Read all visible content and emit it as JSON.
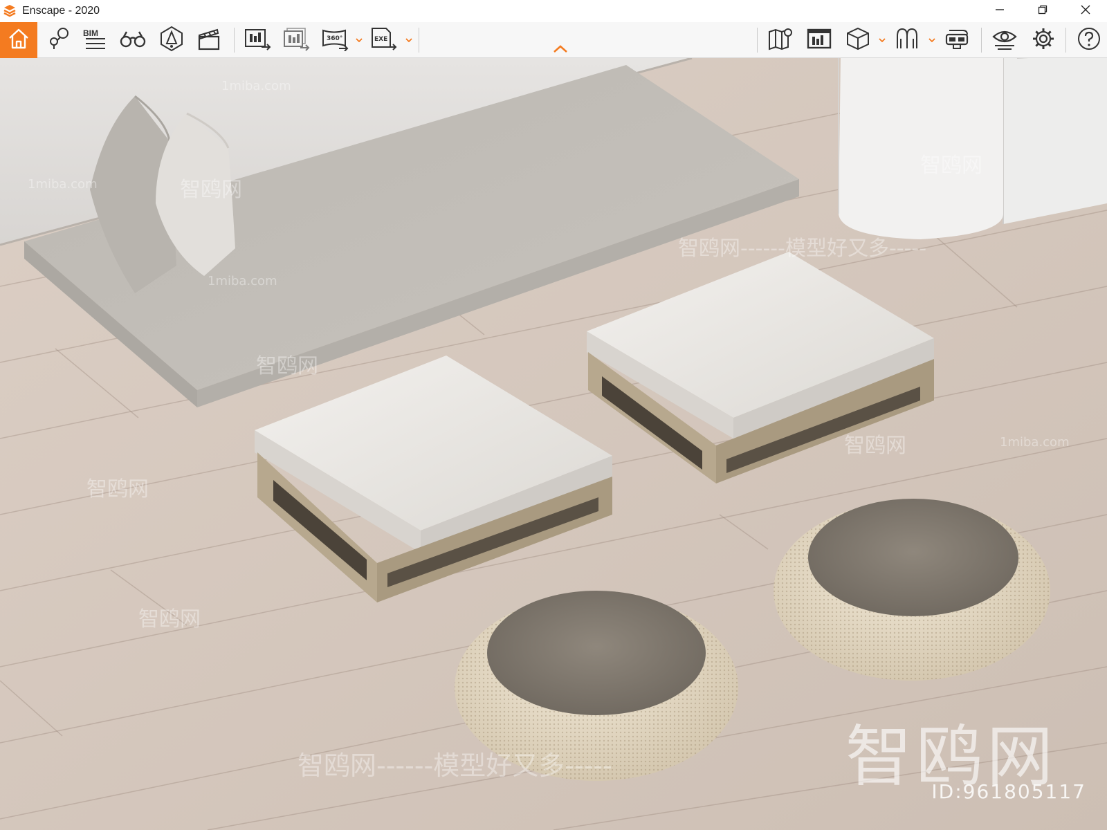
{
  "window": {
    "title": "Enscape - 2020",
    "controls": [
      "minimize-icon",
      "restore-icon",
      "close-icon"
    ]
  },
  "toolbar": {
    "accent_color": "#f47b20",
    "bim_label": "BIM",
    "left_buttons": [
      {
        "name": "home-button",
        "icon": "home-icon"
      },
      {
        "name": "views-button",
        "icon": "views-pin-icon"
      },
      {
        "name": "bim-button",
        "icon": "bim-list-icon"
      },
      {
        "name": "binoculars-button",
        "icon": "binoculars-icon"
      },
      {
        "name": "light-view-button",
        "icon": "light-view-icon"
      },
      {
        "name": "video-editor-button",
        "icon": "clapperboard-icon"
      },
      {
        "name": "screenshot-button",
        "icon": "render-export-icon"
      },
      {
        "name": "batch-render-button",
        "icon": "batch-render-icon"
      },
      {
        "name": "panorama-button",
        "icon": "panorama-360-icon"
      },
      {
        "name": "export-exe-button",
        "icon": "export-exe-icon"
      }
    ],
    "right_buttons": [
      {
        "name": "map-button",
        "icon": "map-icon"
      },
      {
        "name": "material-editor-button",
        "icon": "material-editor-icon"
      },
      {
        "name": "cube-button",
        "icon": "cube-icon"
      },
      {
        "name": "asset-library-button",
        "icon": "asset-library-icon"
      },
      {
        "name": "vr-headset-button",
        "icon": "vr-headset-icon"
      },
      {
        "name": "visual-settings-button",
        "icon": "eye-icon"
      },
      {
        "name": "settings-button",
        "icon": "gear-icon"
      },
      {
        "name": "help-button",
        "icon": "help-icon"
      }
    ]
  },
  "watermarks": {
    "brand": "智鸥网",
    "id_text": "ID:961805117",
    "banner": "智鸥网------模型好又多-----",
    "site": "1miba.com"
  }
}
